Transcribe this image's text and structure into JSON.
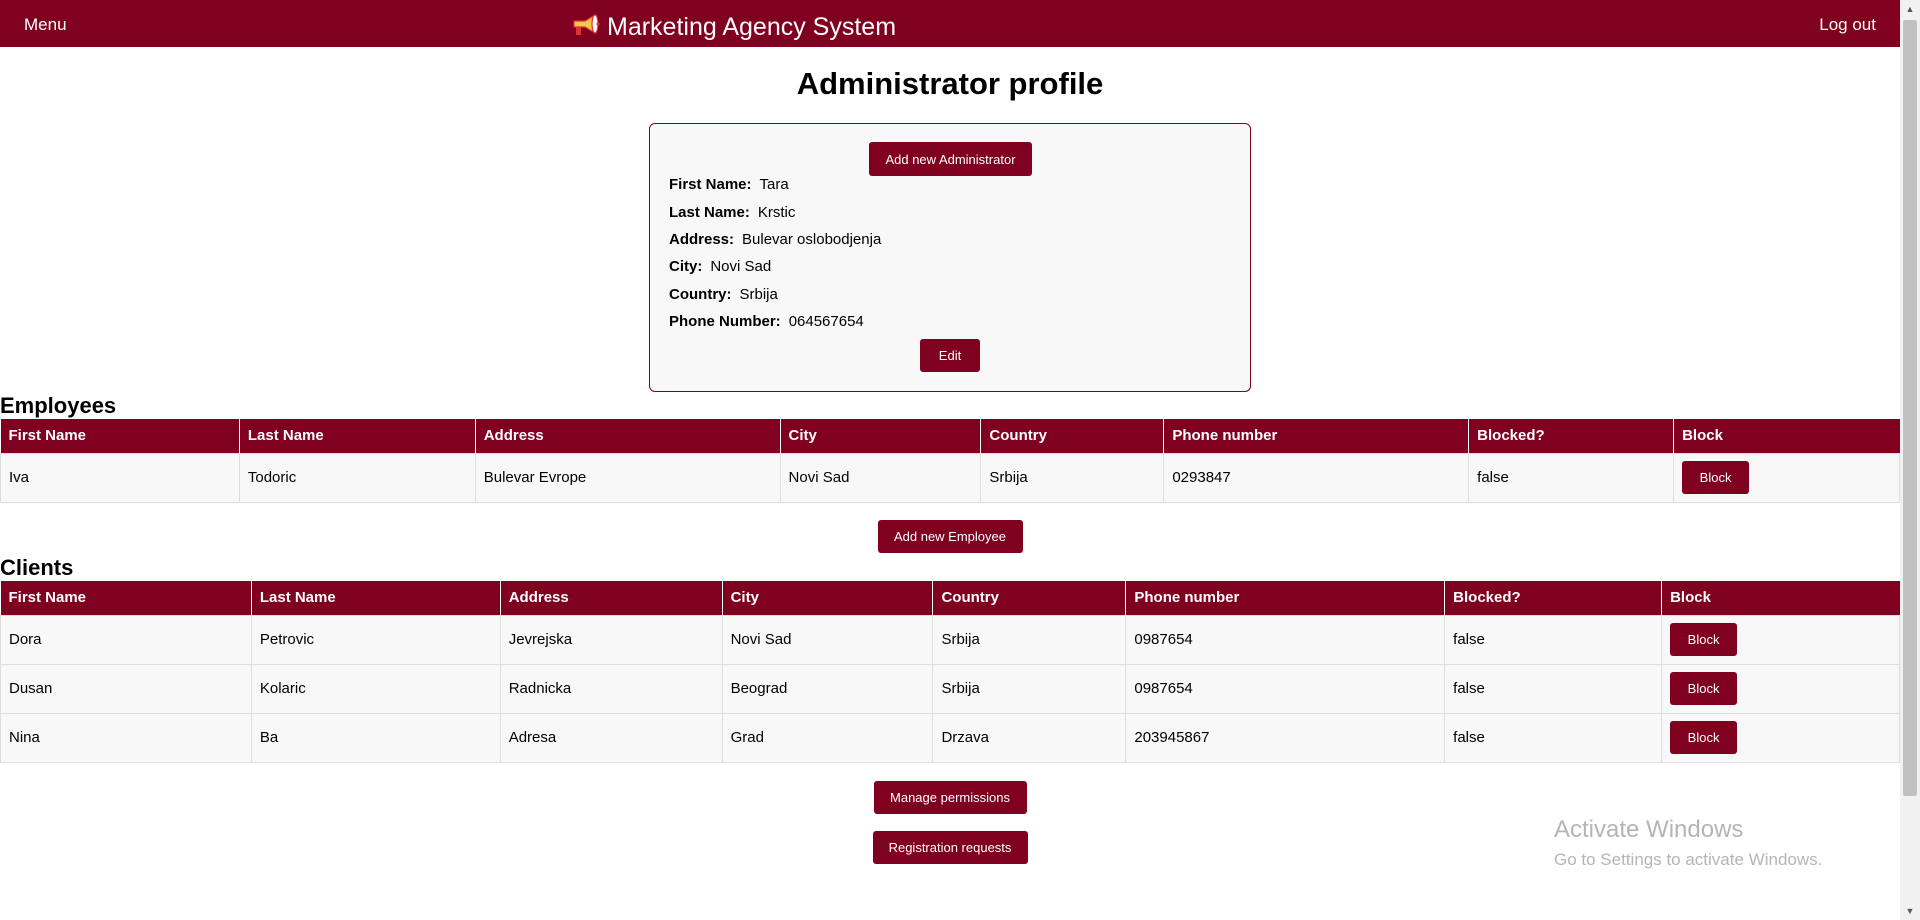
{
  "nav": {
    "menu": "Menu",
    "title": "Marketing Agency System",
    "logo_icon": "megaphone-icon",
    "logout": "Log out"
  },
  "page_title": "Administrator profile",
  "profile": {
    "add_admin_label": "Add new Administrator",
    "fields": [
      {
        "label": "First Name:",
        "value": "Tara"
      },
      {
        "label": "Last Name:",
        "value": "Krstic"
      },
      {
        "label": "Address:",
        "value": "Bulevar oslobodjenja"
      },
      {
        "label": "City:",
        "value": "Novi Sad"
      },
      {
        "label": "Country:",
        "value": "Srbija"
      },
      {
        "label": "Phone Number:",
        "value": "064567654"
      }
    ],
    "edit_label": "Edit"
  },
  "employees": {
    "title": "Employees",
    "headers": [
      "First Name",
      "Last Name",
      "Address",
      "City",
      "Country",
      "Phone number",
      "Blocked?",
      "Block"
    ],
    "rows": [
      {
        "first": "Iva",
        "last": "Todoric",
        "address": "Bulevar Evrope",
        "city": "Novi Sad",
        "country": "Srbija",
        "phone": "0293847",
        "blocked": "false",
        "action": "Block"
      }
    ],
    "add_label": "Add new Employee"
  },
  "clients": {
    "title": "Clients",
    "headers": [
      "First Name",
      "Last Name",
      "Address",
      "City",
      "Country",
      "Phone number",
      "Blocked?",
      "Block"
    ],
    "rows": [
      {
        "first": "Dora",
        "last": "Petrovic",
        "address": "Jevrejska",
        "city": "Novi Sad",
        "country": "Srbija",
        "phone": "0987654",
        "blocked": "false",
        "action": "Block"
      },
      {
        "first": "Dusan",
        "last": "Kolaric",
        "address": "Radnicka",
        "city": "Beograd",
        "country": "Srbija",
        "phone": "0987654",
        "blocked": "false",
        "action": "Block"
      },
      {
        "first": "Nina",
        "last": "Ba",
        "address": "Adresa",
        "city": "Grad",
        "country": "Drzava",
        "phone": "203945867",
        "blocked": "false",
        "action": "Block"
      }
    ]
  },
  "actions": {
    "manage_permissions": "Manage permissions",
    "registration_requests": "Registration requests"
  },
  "watermark": {
    "line1": "Activate Windows",
    "line2": "Go to Settings to activate Windows."
  },
  "colors": {
    "brand": "#800020"
  }
}
